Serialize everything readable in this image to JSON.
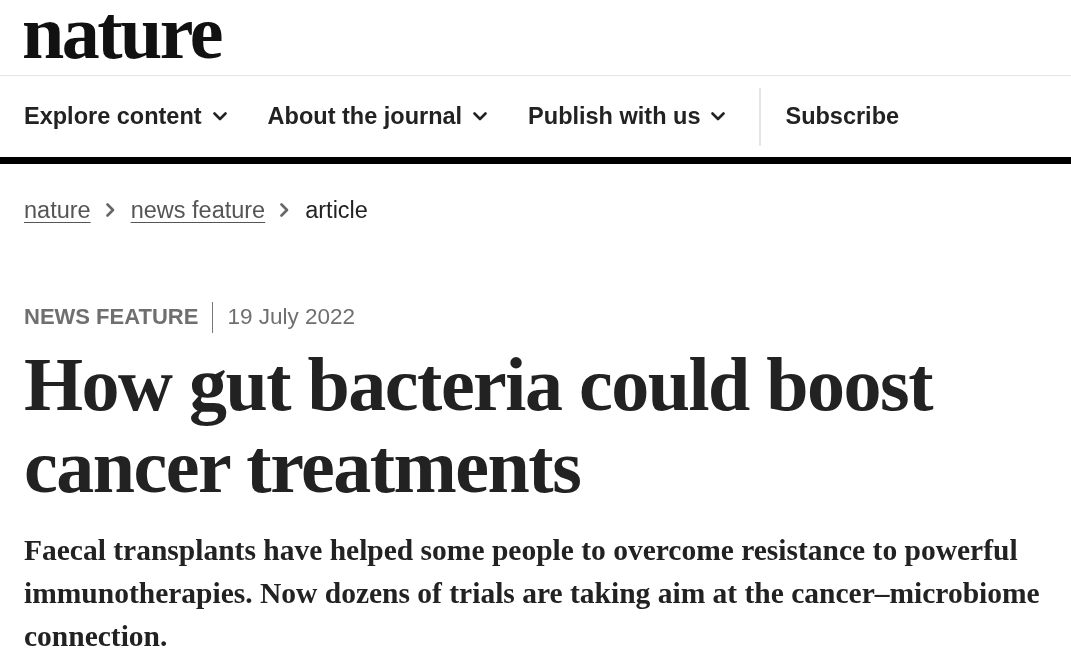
{
  "header": {
    "logo": "nature"
  },
  "nav": {
    "items": [
      {
        "label": "Explore content",
        "kind": "dropdown"
      },
      {
        "label": "About the journal",
        "kind": "dropdown"
      },
      {
        "label": "Publish with us",
        "kind": "dropdown"
      },
      {
        "label": "Subscribe",
        "kind": "link"
      }
    ]
  },
  "breadcrumbs": [
    {
      "label": "nature",
      "current": false
    },
    {
      "label": "news feature",
      "current": false
    },
    {
      "label": "article",
      "current": true
    }
  ],
  "article": {
    "type": "NEWS FEATURE",
    "date": "19 July 2022",
    "title": "How gut bacteria could boost cancer treatments",
    "standfirst": "Faecal transplants have helped some people to overcome resistance to powerful immunotherapies. Now dozens of trials are taking aim at the cancer–microbiome connection."
  }
}
